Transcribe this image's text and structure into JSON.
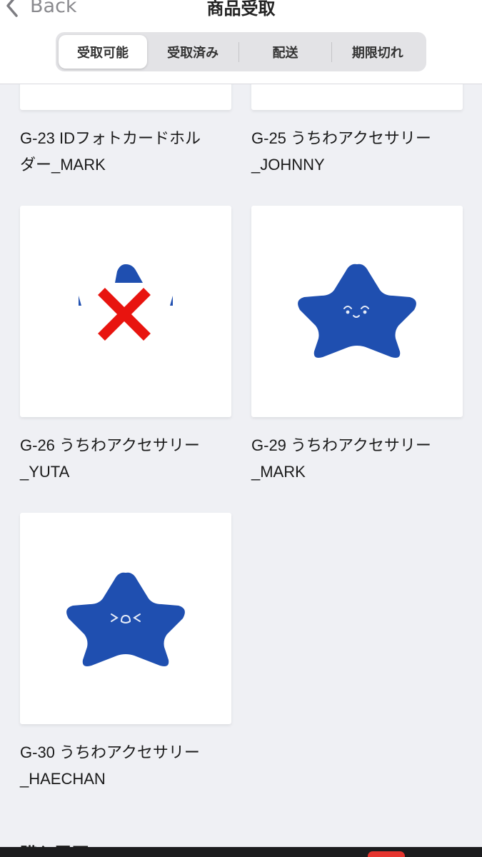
{
  "header": {
    "back_label": "Back",
    "title": "商品受取"
  },
  "tabs": [
    {
      "label": "受取可能",
      "active": true
    },
    {
      "label": "受取済み",
      "active": false
    },
    {
      "label": "配送",
      "active": false
    },
    {
      "label": "期限切れ",
      "active": false
    }
  ],
  "items": [
    {
      "title_line1": "G-23 IDフォトカードホル",
      "title_line2": "ダー_MARK"
    },
    {
      "title_line1": "G-25 うちわアクセサリー",
      "title_line2": "_JOHNNY"
    },
    {
      "title_line1": "G-26 うちわアクセサリー",
      "title_line2": "_YUTA"
    },
    {
      "title_line1": "G-29 うちわアクセサリー",
      "title_line2": "_MARK"
    },
    {
      "title_line1": "G-30 うちわアクセサリー",
      "title_line2": "_HAECHAN"
    }
  ],
  "section_peek": "購入履歴",
  "colors": {
    "star_blue": "#1f4fb0",
    "cross_red": "#e8140f",
    "background": "#eff0f4"
  }
}
